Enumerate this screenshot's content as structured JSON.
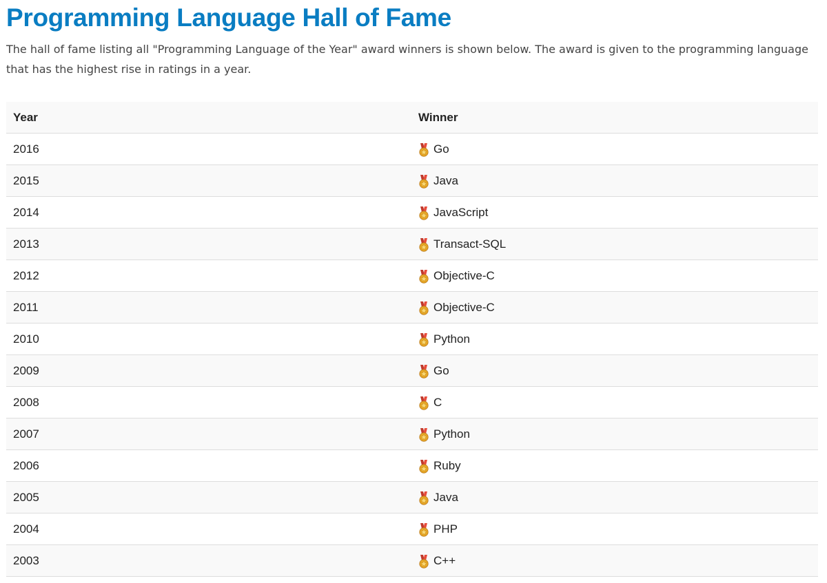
{
  "page": {
    "title": "Programming Language Hall of Fame",
    "intro": "The hall of fame listing all \"Programming Language of the Year\" award winners is shown below. The award is given to the programming language that has the highest rise in ratings in a year."
  },
  "table": {
    "headers": [
      "Year",
      "Winner"
    ],
    "award_icon": "medal-icon",
    "rows": [
      {
        "year": "2016",
        "winner": "Go"
      },
      {
        "year": "2015",
        "winner": "Java"
      },
      {
        "year": "2014",
        "winner": "JavaScript"
      },
      {
        "year": "2013",
        "winner": "Transact-SQL"
      },
      {
        "year": "2012",
        "winner": "Objective-C"
      },
      {
        "year": "2011",
        "winner": "Objective-C"
      },
      {
        "year": "2010",
        "winner": "Python"
      },
      {
        "year": "2009",
        "winner": "Go"
      },
      {
        "year": "2008",
        "winner": "C"
      },
      {
        "year": "2007",
        "winner": "Python"
      },
      {
        "year": "2006",
        "winner": "Ruby"
      },
      {
        "year": "2005",
        "winner": "Java"
      },
      {
        "year": "2004",
        "winner": "PHP"
      },
      {
        "year": "2003",
        "winner": "C++"
      }
    ]
  },
  "colors": {
    "title": "#0a7dc2",
    "header_bg": "#f9f9f9",
    "stripe_bg": "#f9f9f9",
    "border": "#dddddd"
  }
}
